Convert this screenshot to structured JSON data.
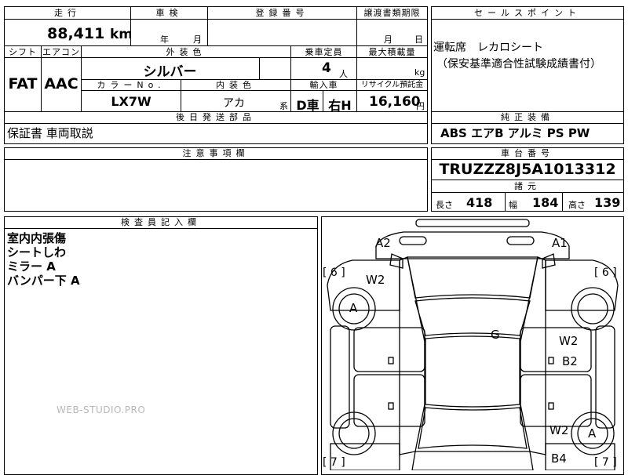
{
  "mileage": {
    "header": "走行",
    "value": "88,411",
    "unit": "km"
  },
  "inspection": {
    "header": "車検",
    "year_label": "年",
    "month_label": "月"
  },
  "registration": {
    "header": "登録番号"
  },
  "transfer_deadline": {
    "header": "譲渡書類期限",
    "month_label": "月",
    "day_label": "日"
  },
  "selling_points": {
    "header": "セールスポイント",
    "line1": "運転席　レカロシート",
    "line2": "（保安基準適合性試験成績書付）"
  },
  "shift": {
    "header": "シフト",
    "value": "FAT"
  },
  "aircon": {
    "header": "エアコン",
    "value": "AAC"
  },
  "exterior_color": {
    "header": "外装色",
    "value": "シルバー"
  },
  "capacity": {
    "header": "乗車定員",
    "value": "4",
    "unit": "人"
  },
  "max_load": {
    "header": "最大積載量",
    "unit": "kg"
  },
  "color_no": {
    "header": "カラーNo.",
    "value": "LX7W"
  },
  "interior_color": {
    "header": "内装色",
    "value": "アカ",
    "suffix": "系"
  },
  "import": {
    "header": "輸入車",
    "value1": "D車",
    "value2": "右H"
  },
  "recycle": {
    "header": "リサイクル預託金",
    "value": "16,160",
    "unit": "円"
  },
  "later_parts": {
    "header": "後日発送部品",
    "value": "保証書 車両取説"
  },
  "standard_equipment": {
    "header": "純正装備",
    "value": "ABS エアB アルミ PS PW"
  },
  "notes": {
    "header": "注意事項欄"
  },
  "chassis": {
    "header": "車台番号",
    "value": "TRUZZZ8J5A1013312"
  },
  "specs": {
    "header": "諸元",
    "length_label": "長さ",
    "length": "418",
    "width_label": "幅",
    "width": "184",
    "height_label": "高さ",
    "height": "139"
  },
  "inspector": {
    "header": "検査員記入欄",
    "lines": [
      "室内内張傷",
      "シートしわ",
      "ミラー A",
      "バンパー下 A"
    ]
  },
  "watermark": "WEB-STUDIO.PRO",
  "diagram": {
    "labels": {
      "a2": "A2",
      "a1": "A1",
      "w2_left": "W2",
      "a_left": "A",
      "g": "G",
      "w2_right_mid": "W2",
      "b2": "B2",
      "w2_right_low": "W2",
      "a_right": "A",
      "b4": "B4"
    },
    "brackets": {
      "left_top": "[ 6 ]",
      "right_top": "[ 6 ]",
      "left_bottom": "[ 7 ]",
      "right_bottom": "[ 7 ]"
    }
  }
}
